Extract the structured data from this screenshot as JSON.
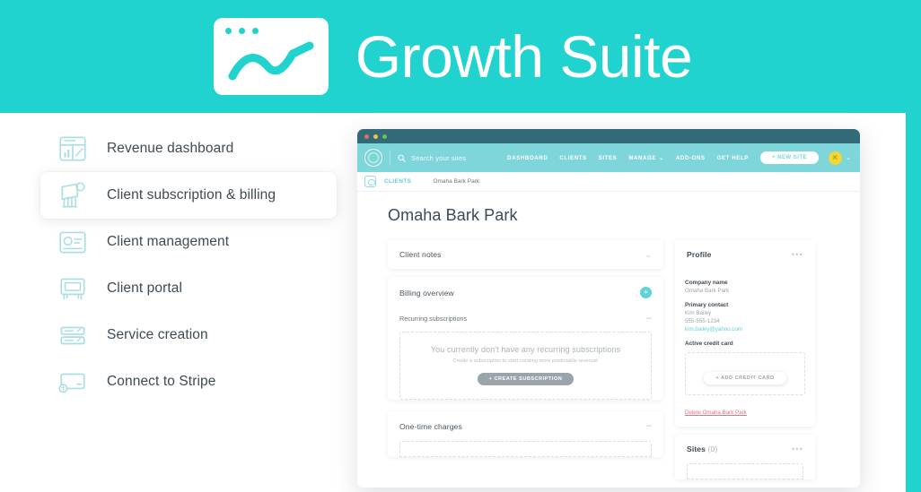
{
  "header": {
    "brand_title": "Growth Suite",
    "logo_icon": "window-chart-icon",
    "bg_color": "#21d3ce"
  },
  "sidebar": {
    "items": [
      {
        "label": "Revenue dashboard",
        "icon": "dashboard-report-icon",
        "active": false
      },
      {
        "label": "Client subscription & billing",
        "icon": "hand-invoice-icon",
        "active": true
      },
      {
        "label": "Client management",
        "icon": "contact-card-icon",
        "active": false
      },
      {
        "label": "Client portal",
        "icon": "portal-kiosk-icon",
        "active": false
      },
      {
        "label": "Service creation",
        "icon": "stacked-rows-icon",
        "active": false
      },
      {
        "label": "Connect to Stripe",
        "icon": "credit-card-icon",
        "active": false
      }
    ]
  },
  "browser": {
    "traffic_lights": [
      "close-red",
      "minimize-yellow",
      "maximize-green"
    ],
    "nav": {
      "logo_icon": "circular-logo-icon",
      "search_icon": "search-icon",
      "search_placeholder": "Search your sites",
      "links": [
        "DASHBOARD",
        "CLIENTS",
        "SITES",
        "MANAGE",
        "ADD-ONS",
        "GET HELP"
      ],
      "manage_caret": "⌄",
      "new_site_label": "+ NEW SITE",
      "avatar_initial": "K",
      "avatar_color": "#f2d832",
      "avatar_caret": "⌄"
    },
    "breadcrumb": {
      "icon": "clients-badge-icon",
      "root": "CLIENTS",
      "current": "Omaha Bark Park"
    },
    "page_title": "Omaha Bark Park",
    "left_column": {
      "client_notes": {
        "title": "Client notes",
        "toggle_icon": "chevron-down-icon"
      },
      "billing_overview": {
        "title": "Billing overview",
        "add_icon": "plus-circle-icon",
        "recurring": {
          "title": "Recurring subscriptions",
          "collapse_icon": "minus-icon",
          "empty_heading": "You currently don't have any recurring subscriptions",
          "empty_sub": "Create a subscription to start creating more predictable revenue!",
          "cta_label": "+ CREATE SUBSCRIPTION"
        }
      },
      "one_time_charges": {
        "title": "One-time charges",
        "collapse_icon": "minus-icon"
      }
    },
    "right_column": {
      "profile": {
        "title": "Profile",
        "menu_icon": "ellipsis-icon",
        "company_label": "Company name",
        "company_value": "Omaha Bark Park",
        "contact_label": "Primary contact",
        "contact_name": "Kim Bailey",
        "contact_phone": "555-555-1234",
        "contact_email": "kim.bailey@yahoo.com",
        "credit_card_label": "Active credit card",
        "add_card_label": "+ ADD CREDIT CARD",
        "delete_label": "Delete Omaha Bark Park",
        "delete_color": "#ef6d7e"
      },
      "sites": {
        "title": "Sites",
        "count": "(0)",
        "menu_icon": "ellipsis-icon"
      }
    }
  },
  "theme": {
    "teal": "#21d3ce",
    "nav_teal": "#7ed6da",
    "titlebar": "#336a78",
    "accent_circle": "#5fd4d8"
  }
}
